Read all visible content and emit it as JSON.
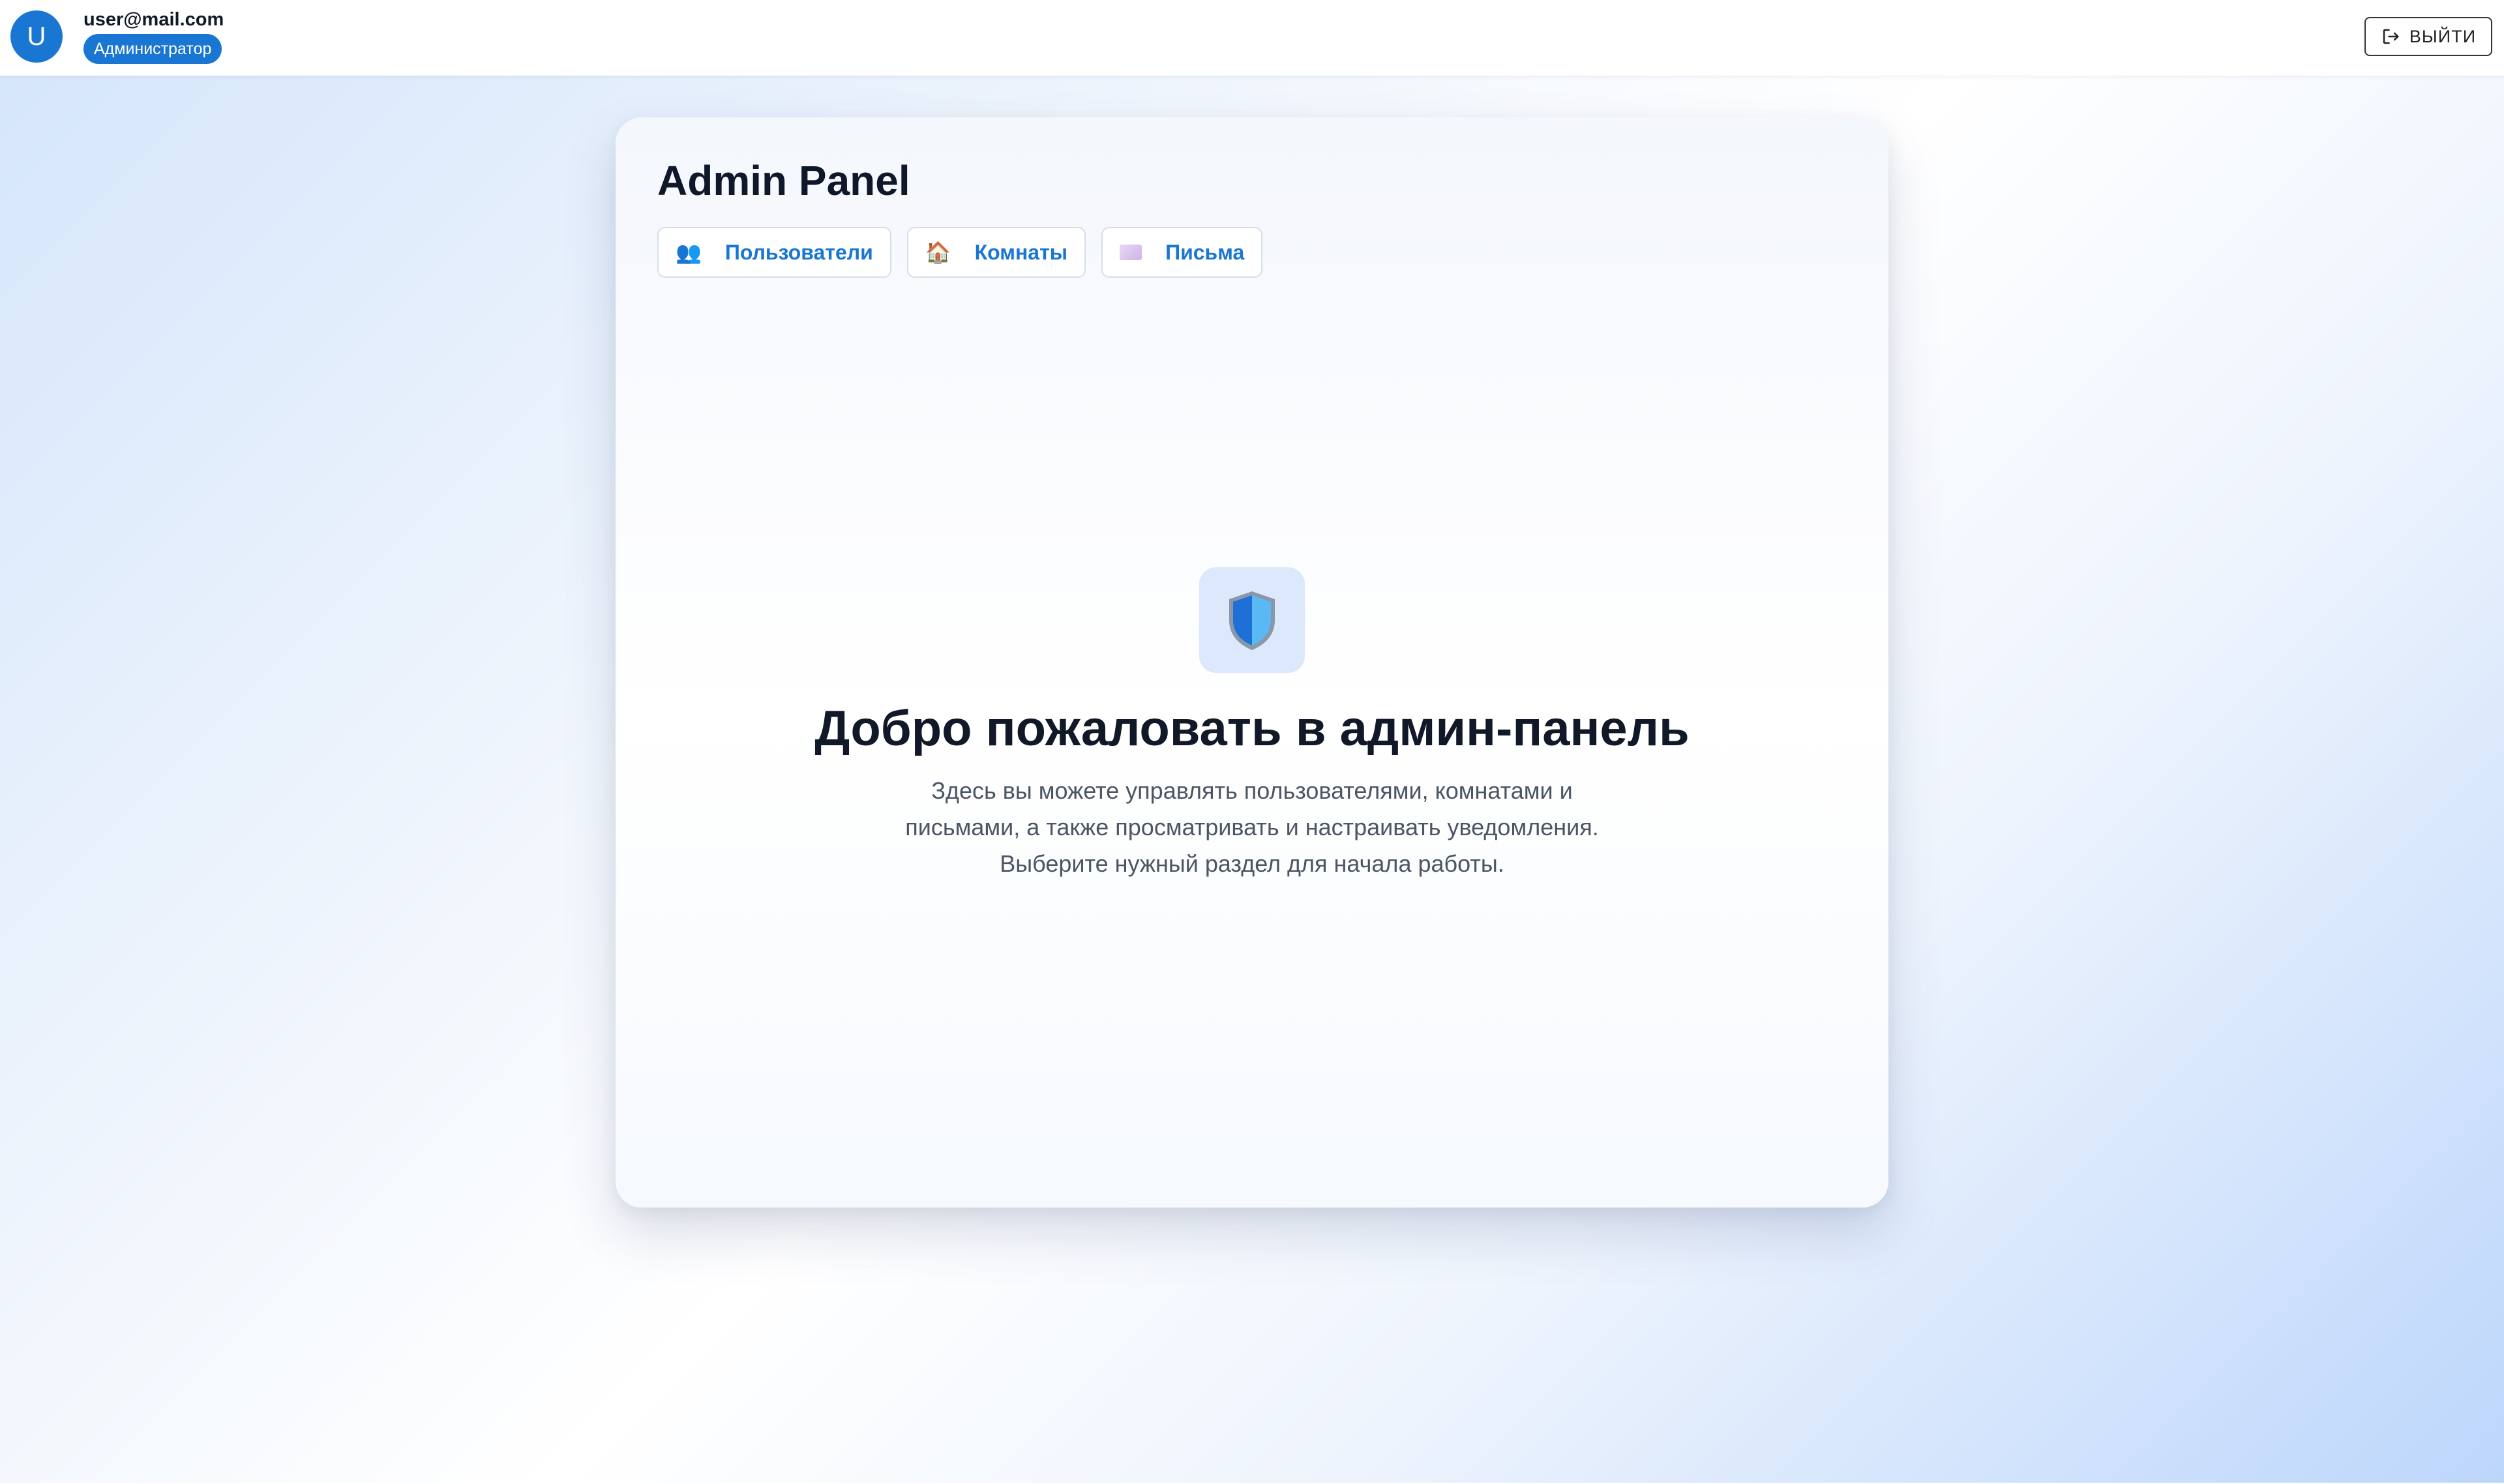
{
  "user": {
    "avatar_letter": "U",
    "email": "user@mail.com",
    "role": "Администратор"
  },
  "header": {
    "logout_label": "ВЫЙТИ"
  },
  "panel": {
    "title": "Admin Panel",
    "tabs": [
      {
        "icon": "users-icon",
        "label": "Пользователи"
      },
      {
        "icon": "house-icon",
        "label": "Комнаты"
      },
      {
        "icon": "envelope-icon",
        "label": "Письма"
      }
    ]
  },
  "welcome": {
    "icon": "shield-icon",
    "title": "Добро пожаловать в админ-панель",
    "text": "Здесь вы можете управлять пользователями, комнатами и письмами, а также просматривать и настраивать уведомления. Выберите нужный раздел для начала работы."
  },
  "colors": {
    "accent": "#1976d2",
    "heading": "#111827",
    "body_text": "#4b5563",
    "shield_bg": "#dce8fb"
  }
}
